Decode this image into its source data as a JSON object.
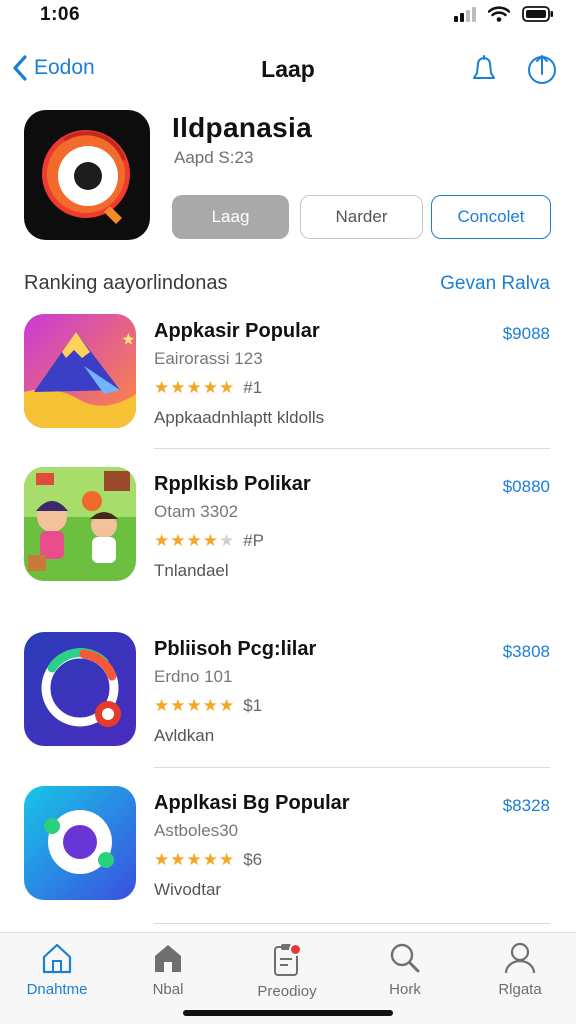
{
  "status_bar": {
    "time": "1:06"
  },
  "nav": {
    "back_label": "Eodon",
    "title": "Laap"
  },
  "app": {
    "name": "Ildpanasia",
    "subtitle": "Aapd S:23",
    "buttons": [
      "Laag",
      "Narder",
      "Concolet"
    ]
  },
  "section": {
    "title": "Ranking aayorlindonas",
    "link": "Gevan Ralva"
  },
  "apps": [
    {
      "name": "Appkasir Popular",
      "sub": "Eairorassi 123",
      "stars": 5,
      "rating_text": "#1",
      "category": "Appkaadnhlaptt kldolls",
      "price": "$9088"
    },
    {
      "name": "Rpplkisb Polikar",
      "sub": "Otam 3302",
      "stars": 4,
      "rating_text": "#P",
      "category": "Tnlandael",
      "price": "$0880"
    },
    {
      "name": "Pbliisoh Pcg:lilar",
      "sub": "Erdno 101",
      "stars": 5,
      "rating_text": "$1",
      "category": "Avldkan",
      "price": "$3808"
    },
    {
      "name": "Applkasi Bg Popular",
      "sub": "Astboles30",
      "stars": 5,
      "rating_text": "$6",
      "category": "Wivodtar",
      "price": "$8328"
    }
  ],
  "tabs": [
    {
      "label": "Dnahtme",
      "icon": "home-icon",
      "active": true
    },
    {
      "label": "Nbal",
      "icon": "store-icon",
      "active": false
    },
    {
      "label": "Preodioy",
      "icon": "clipboard-icon",
      "active": false
    },
    {
      "label": "Hork",
      "icon": "search-icon",
      "active": false
    },
    {
      "label": "Rlgata",
      "icon": "person-icon",
      "active": false
    }
  ],
  "colors": {
    "accent": "#1a7fd6",
    "star": "#f5a623",
    "badge": "#e53935"
  }
}
